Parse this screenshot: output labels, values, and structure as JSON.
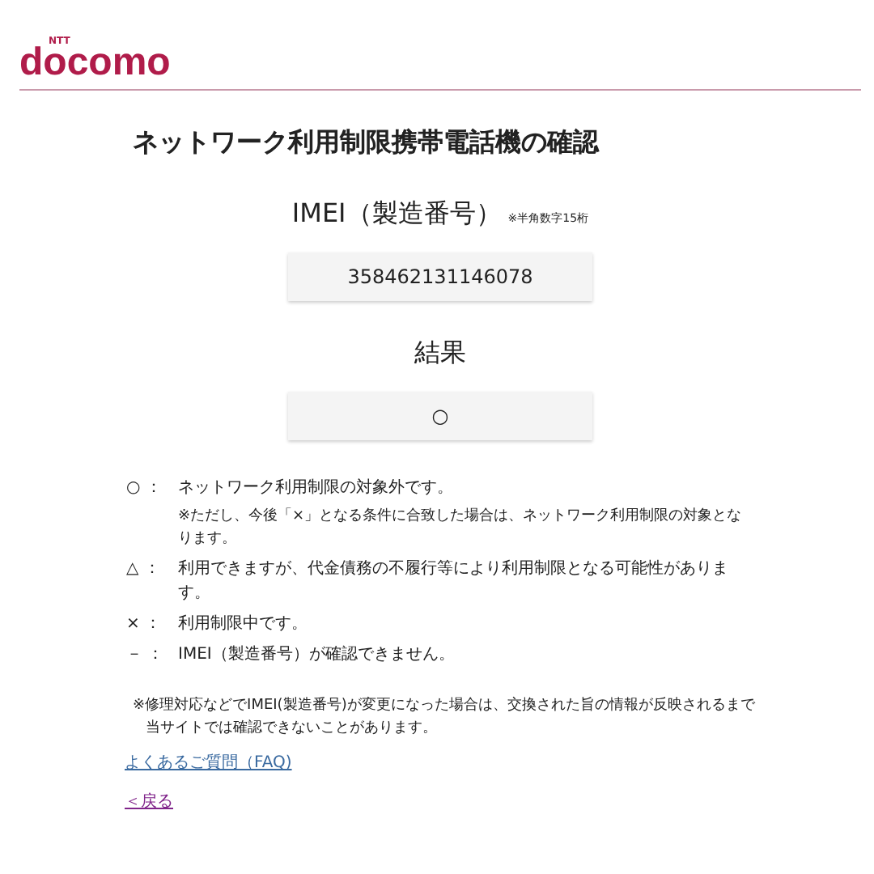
{
  "header": {
    "logo_small": "NTT",
    "logo": "docomo"
  },
  "title": "ネットワーク利用制限携帯電話機の確認",
  "imei": {
    "label": "IMEI（製造番号）",
    "hint": "※半角数字15桁",
    "value": "358462131146078"
  },
  "result": {
    "label": "結果",
    "value": "○"
  },
  "legend": [
    {
      "symbol": "○ ：",
      "text": "ネットワーク利用制限の対象外です。",
      "note": "※ただし、今後「×」となる条件に合致した場合は、ネットワーク利用制限の対象となります。"
    },
    {
      "symbol": "△ ：",
      "text": "利用できますが、代金債務の不履行等により利用制限となる可能性があります。"
    },
    {
      "symbol": "× ：",
      "text": "利用制限中です。"
    },
    {
      "symbol": "－ ：",
      "text": "IMEI（製造番号）が確認できません。"
    }
  ],
  "footnote": "※修理対応などでIMEI(製造番号)が変更になった場合は、交換された旨の情報が反映されるまで当サイトでは確認できないことがあります。",
  "links": [
    "よくあるご質問（FAQ)",
    "＜戻る"
  ]
}
